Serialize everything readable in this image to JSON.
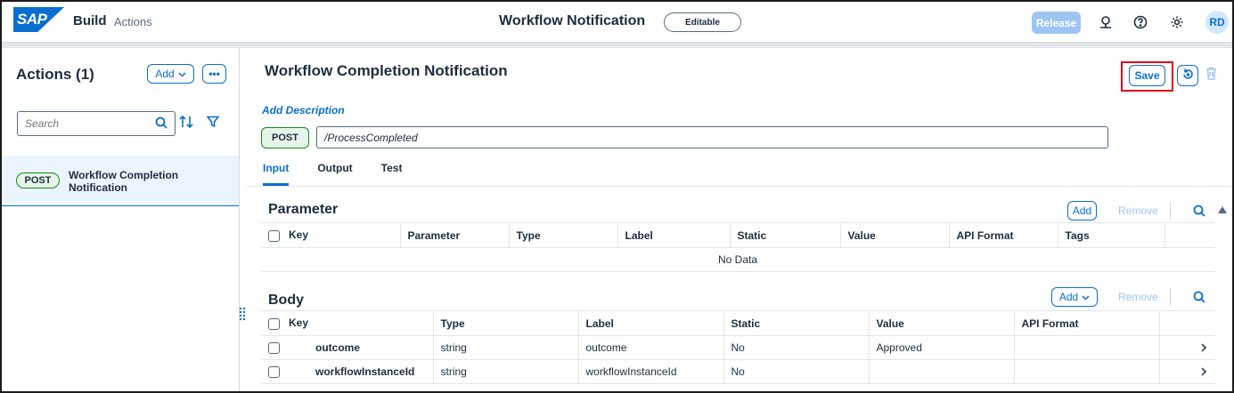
{
  "shell": {
    "logo": "SAP",
    "logo_mark": "®",
    "brand": "Build",
    "section": "Actions",
    "title": "Workflow Notification",
    "status": "Editable",
    "release": "Release",
    "avatar": "RD",
    "icons": [
      "feedback-icon",
      "help-icon",
      "settings-icon"
    ]
  },
  "left": {
    "title": "Actions (1)",
    "add_label": "Add",
    "more_label": "•••",
    "search_placeholder": "Search",
    "items": [
      {
        "method": "POST",
        "name": "Workflow Completion Notification"
      }
    ]
  },
  "detail": {
    "title": "Workflow Completion Notification",
    "save": "Save",
    "add_description": "Add Description",
    "method": "POST",
    "path": "/ProcessCompleted",
    "tabs": [
      "Input",
      "Output",
      "Test"
    ],
    "active_tab": "Input"
  },
  "parameter": {
    "title": "Parameter",
    "add": "Add",
    "remove": "Remove",
    "columns": [
      "Key",
      "Parameter",
      "Type",
      "Label",
      "Static",
      "Value",
      "API Format",
      "Tags"
    ],
    "empty": "No Data"
  },
  "body": {
    "title": "Body",
    "add": "Add",
    "remove": "Remove",
    "columns": [
      "Key",
      "Type",
      "Label",
      "Static",
      "Value",
      "API Format"
    ],
    "rows": [
      {
        "key": "outcome",
        "type": "string",
        "label": "outcome",
        "static": "No",
        "value": "Approved",
        "api_format": ""
      },
      {
        "key": "workflowInstanceId",
        "type": "string",
        "label": "workflowInstanceId",
        "static": "No",
        "value": "",
        "api_format": ""
      }
    ]
  },
  "colors": {
    "accent": "#0a6ed1",
    "post_badge_border": "#188918",
    "post_badge_bg": "#e5f5e9",
    "highlight": "#e3001b"
  }
}
